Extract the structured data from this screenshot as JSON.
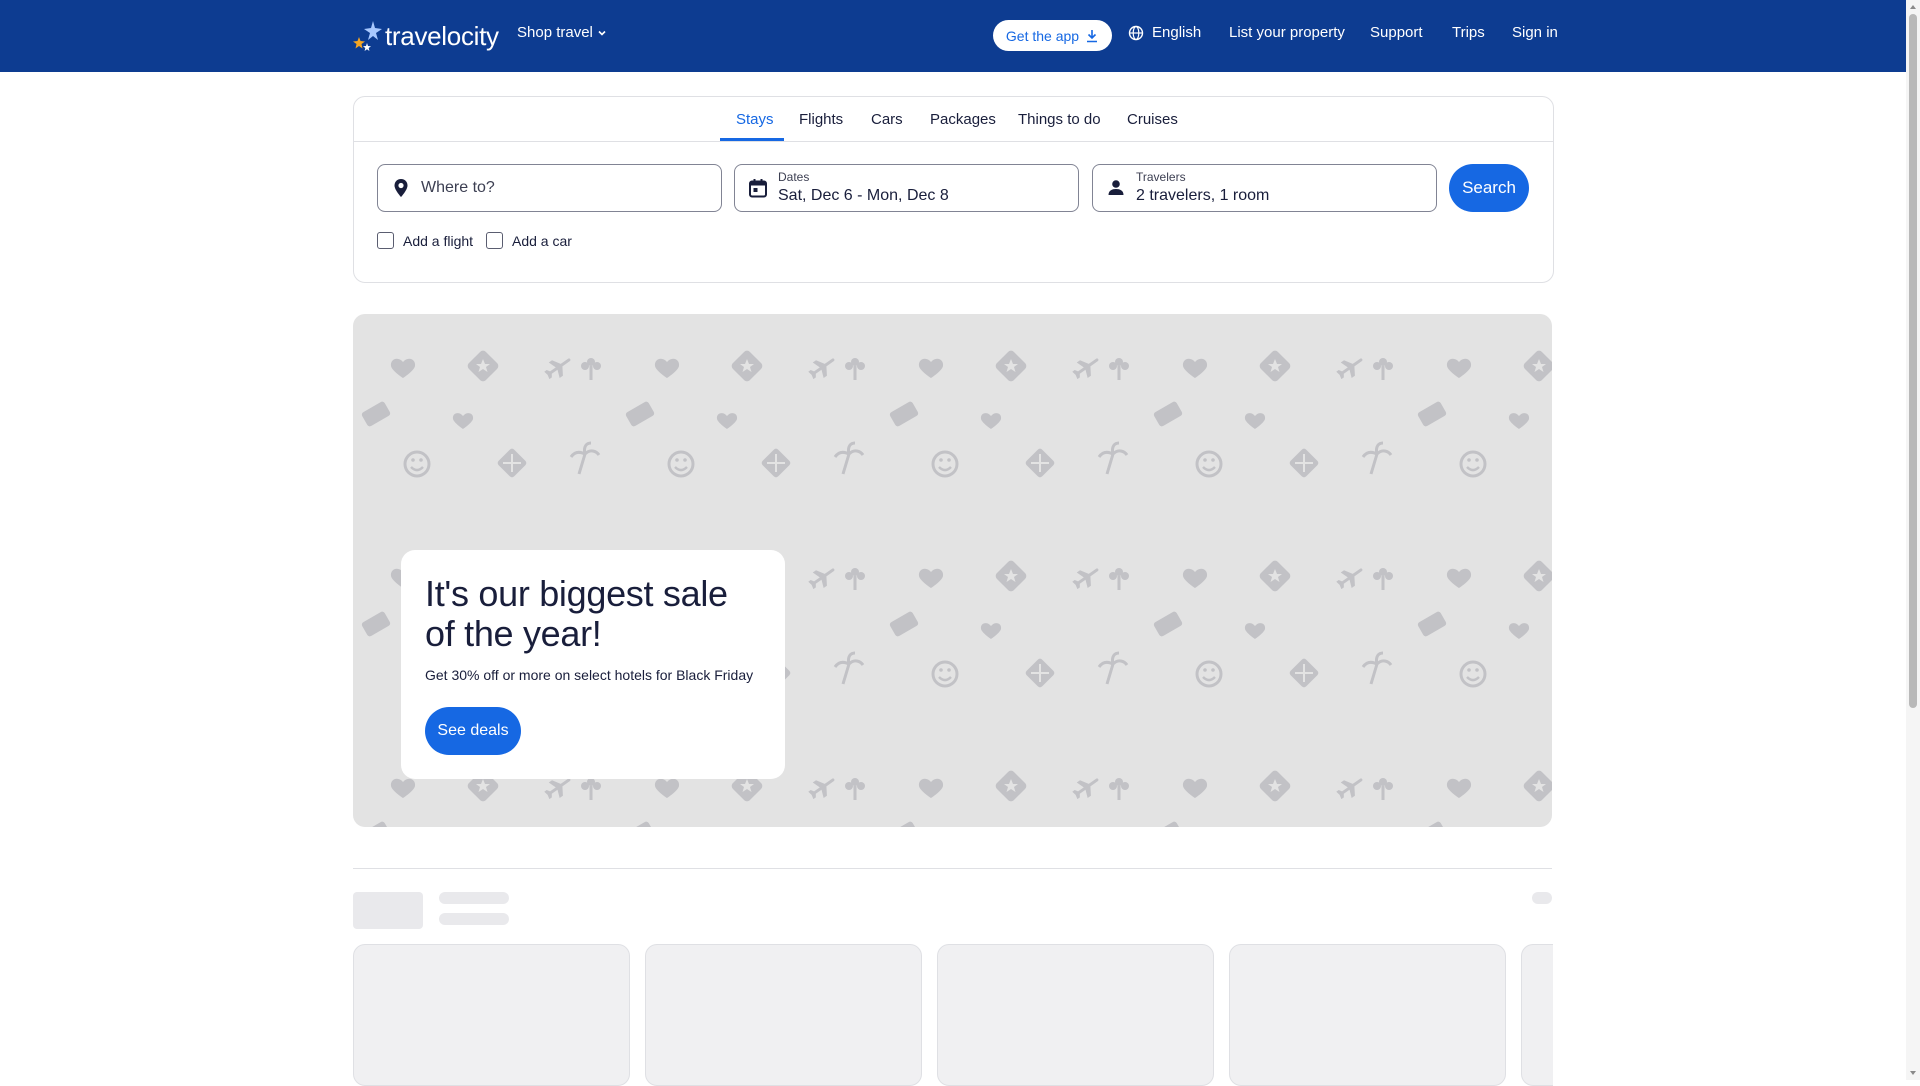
{
  "header": {
    "logo_text": "travelocity",
    "shop_travel": "Shop travel",
    "get_app": "Get the app",
    "language": "English",
    "list_property": "List your property",
    "support": "Support",
    "trips": "Trips",
    "sign_in": "Sign in"
  },
  "tabs": [
    "Stays",
    "Flights",
    "Cars",
    "Packages",
    "Things to do",
    "Cruises"
  ],
  "active_tab": "Stays",
  "search": {
    "destination_placeholder": "Where to?",
    "dates_label": "Dates",
    "dates_value": "Sat, Dec 6 - Mon, Dec 8",
    "travelers_label": "Travelers",
    "travelers_value": "2 travelers, 1 room",
    "search_button": "Search",
    "add_flight": "Add a flight",
    "add_car": "Add a car"
  },
  "promo": {
    "title": "It's our biggest sale of the year!",
    "subtitle": "Get 30% off or more on select hotels for Black Friday",
    "button": "See deals"
  },
  "colors": {
    "header_bg": "#0d3c91",
    "accent": "#1668e3",
    "promo_bg": "#e3e3e3",
    "pattern_icon": "#bfbfc2"
  },
  "icons": {
    "destination": "map-pin-icon",
    "dates": "calendar-icon",
    "travelers": "person-icon",
    "language": "globe-icon",
    "get_app": "download-icon"
  }
}
